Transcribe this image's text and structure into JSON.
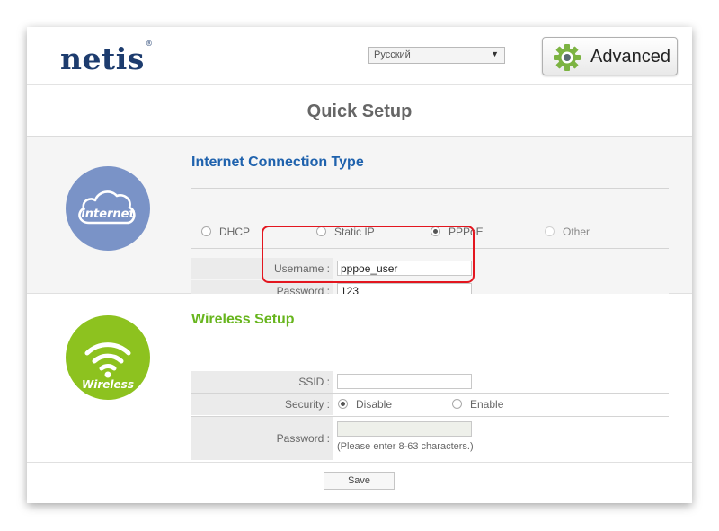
{
  "header": {
    "logo_text": "netis",
    "logo_mark": "®",
    "language_selected": "Русский",
    "advanced_label": "Advanced",
    "advanced_icon": "gear-icon"
  },
  "page": {
    "title": "Quick Setup"
  },
  "internet": {
    "icon_text": "internet",
    "icon": "cloud-icon",
    "title": "Internet Connection Type",
    "options": [
      {
        "label": "DHCP",
        "selected": false
      },
      {
        "label": "Static IP",
        "selected": false
      },
      {
        "label": "PPPoE",
        "selected": true
      },
      {
        "label": "Other",
        "selected": false
      }
    ],
    "username_label": "Username :",
    "username_value": "pppoe_user",
    "password_label": "Password :",
    "password_value": "123"
  },
  "wireless": {
    "icon_text": "Wireless",
    "icon": "wifi-icon",
    "title": "Wireless Setup",
    "ssid_label": "SSID :",
    "ssid_value": "",
    "security_label": "Security :",
    "security_options": [
      {
        "label": "Disable",
        "selected": true
      },
      {
        "label": "Enable",
        "selected": false
      }
    ],
    "password_label": "Password :",
    "password_value": "",
    "password_hint": "(Please enter 8-63 characters.)"
  },
  "actions": {
    "save_label": "Save"
  },
  "colors": {
    "brand": "#1d3c6e",
    "internet_blue": "#7a93c7",
    "wireless_green": "#8dc21f",
    "highlight_red": "#e3161f"
  }
}
